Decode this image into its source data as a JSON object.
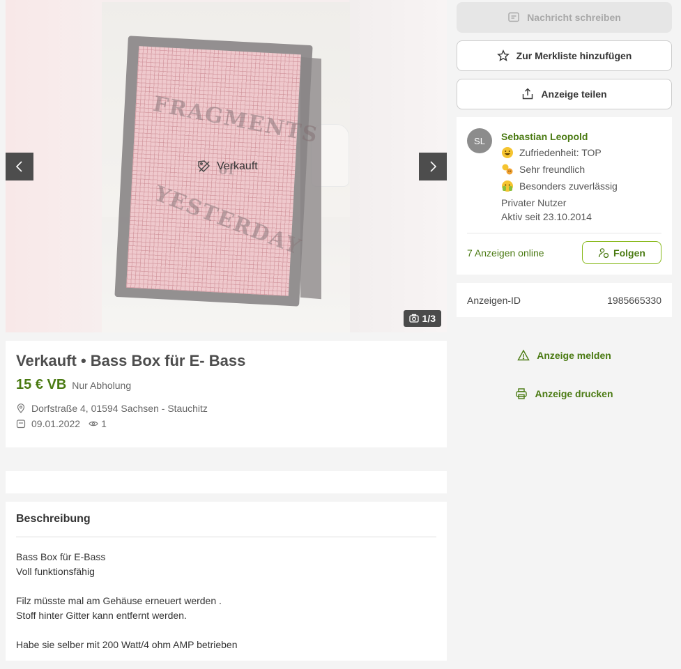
{
  "gallery": {
    "counter": "1/3",
    "sold_label": "Verkauft",
    "prev_label": "previous-image",
    "next_label": "next-image"
  },
  "listing": {
    "title_prefix": "Verkauft",
    "title_separator": "•",
    "title": "Bass Box für E- Bass",
    "price": "15 € VB",
    "shipping": "Nur Abholung",
    "location": "Dorfstraße 4, 01594 Sachsen - Stauchitz",
    "date": "09.01.2022",
    "views": "1"
  },
  "description": {
    "heading": "Beschreibung",
    "lines": [
      "Bass Box für E-Bass",
      "Voll funktionsfähig",
      "",
      "Filz müsste mal am Gehäuse erneuert werden .",
      "Stoff hinter Gitter kann entfernt werden.",
      "",
      "Habe sie selber mit 200 Watt/4 ohm AMP betrieben"
    ]
  },
  "actions": {
    "message": "Nachricht schreiben",
    "watchlist": "Zur Merkliste hinzufügen",
    "share": "Anzeige teilen",
    "report": "Anzeige melden",
    "print": "Anzeige drucken"
  },
  "seller": {
    "initials": "SL",
    "name": "Sebastian Leopold",
    "badges": [
      {
        "icon": "grinning-face-icon",
        "label": "Zufriedenheit: TOP"
      },
      {
        "icon": "friendly-icon",
        "label": "Sehr freundlich"
      },
      {
        "icon": "reliable-icon",
        "label": "Besonders zuverlässig"
      }
    ],
    "type": "Privater Nutzer",
    "active_since": "Aktiv seit 23.10.2014",
    "ads_online": "7 Anzeigen online",
    "follow": "Folgen"
  },
  "ad_id": {
    "label": "Anzeigen-ID",
    "value": "1985665330"
  },
  "colors": {
    "accent": "#4a7a12",
    "accent_border": "#86b817",
    "background": "#f4f4f4"
  }
}
